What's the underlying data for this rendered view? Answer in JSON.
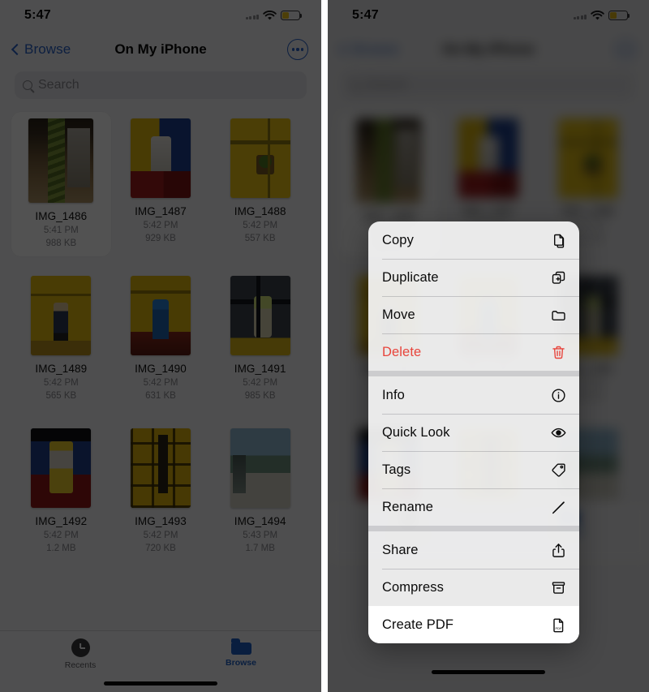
{
  "status_bar": {
    "time": "5:47",
    "battery_icon": "battery-low-power-icon",
    "wifi_icon": "wifi-icon",
    "signal_icon": "cellular-signal-icon"
  },
  "nav": {
    "back_label": "Browse",
    "back_icon": "chevron-left-icon",
    "title": "On My iPhone",
    "more_icon": "ellipsis-circle-icon"
  },
  "search": {
    "placeholder": "Search",
    "icon": "search-icon"
  },
  "files": [
    {
      "name": "IMG_1486",
      "time": "5:41 PM",
      "size": "988 KB",
      "art": "a-cafe",
      "selected": true
    },
    {
      "name": "IMG_1487",
      "time": "5:42 PM",
      "size": "929 KB",
      "art": "a-yb",
      "selected": false
    },
    {
      "name": "IMG_1488",
      "time": "5:42 PM",
      "size": "557 KB",
      "art": "a-y2",
      "selected": false
    },
    {
      "name": "IMG_1489",
      "time": "5:42 PM",
      "size": "565 KB",
      "art": "a-fig1",
      "selected": false
    },
    {
      "name": "IMG_1490",
      "time": "5:42 PM",
      "size": "631 KB",
      "art": "a-fig2",
      "selected": false
    },
    {
      "name": "IMG_1491",
      "time": "5:42 PM",
      "size": "985 KB",
      "art": "a-dark",
      "selected": false
    },
    {
      "name": "IMG_1492",
      "time": "5:42 PM",
      "size": "1.2 MB",
      "art": "a-blue",
      "selected": false
    },
    {
      "name": "IMG_1493",
      "time": "5:42 PM",
      "size": "720 KB",
      "art": "a-grid",
      "selected": false
    },
    {
      "name": "IMG_1494",
      "time": "5:43 PM",
      "size": "1.7 MB",
      "art": "a-city",
      "selected": false
    }
  ],
  "tabbar": {
    "recents_label": "Recents",
    "recents_icon": "clock-icon",
    "browse_label": "Browse",
    "browse_icon": "folder-icon",
    "active": "Browse"
  },
  "context_menu": {
    "groups": [
      {
        "items": [
          {
            "label": "Copy",
            "icon": "copy-icon",
            "style": "normal"
          },
          {
            "label": "Duplicate",
            "icon": "duplicate-icon",
            "style": "normal"
          },
          {
            "label": "Move",
            "icon": "folder-icon",
            "style": "normal"
          },
          {
            "label": "Delete",
            "icon": "trash-icon",
            "style": "destructive"
          }
        ]
      },
      {
        "items": [
          {
            "label": "Info",
            "icon": "info-circle-icon",
            "style": "normal"
          },
          {
            "label": "Quick Look",
            "icon": "eye-icon",
            "style": "normal"
          },
          {
            "label": "Tags",
            "icon": "tag-icon",
            "style": "normal"
          },
          {
            "label": "Rename",
            "icon": "pencil-icon",
            "style": "normal"
          }
        ]
      },
      {
        "items": [
          {
            "label": "Share",
            "icon": "share-icon",
            "style": "normal"
          },
          {
            "label": "Compress",
            "icon": "archive-box-icon",
            "style": "normal"
          },
          {
            "label": "Create PDF",
            "icon": "pdf-doc-icon",
            "style": "highlighted"
          }
        ]
      }
    ]
  },
  "colors": {
    "accent_blue": "#1d5fc4",
    "destructive_red": "#e8453c",
    "battery_yellow": "#f0c419",
    "screen_bg": "#f2f2f4",
    "menu_bg": "#f9f9f9"
  }
}
